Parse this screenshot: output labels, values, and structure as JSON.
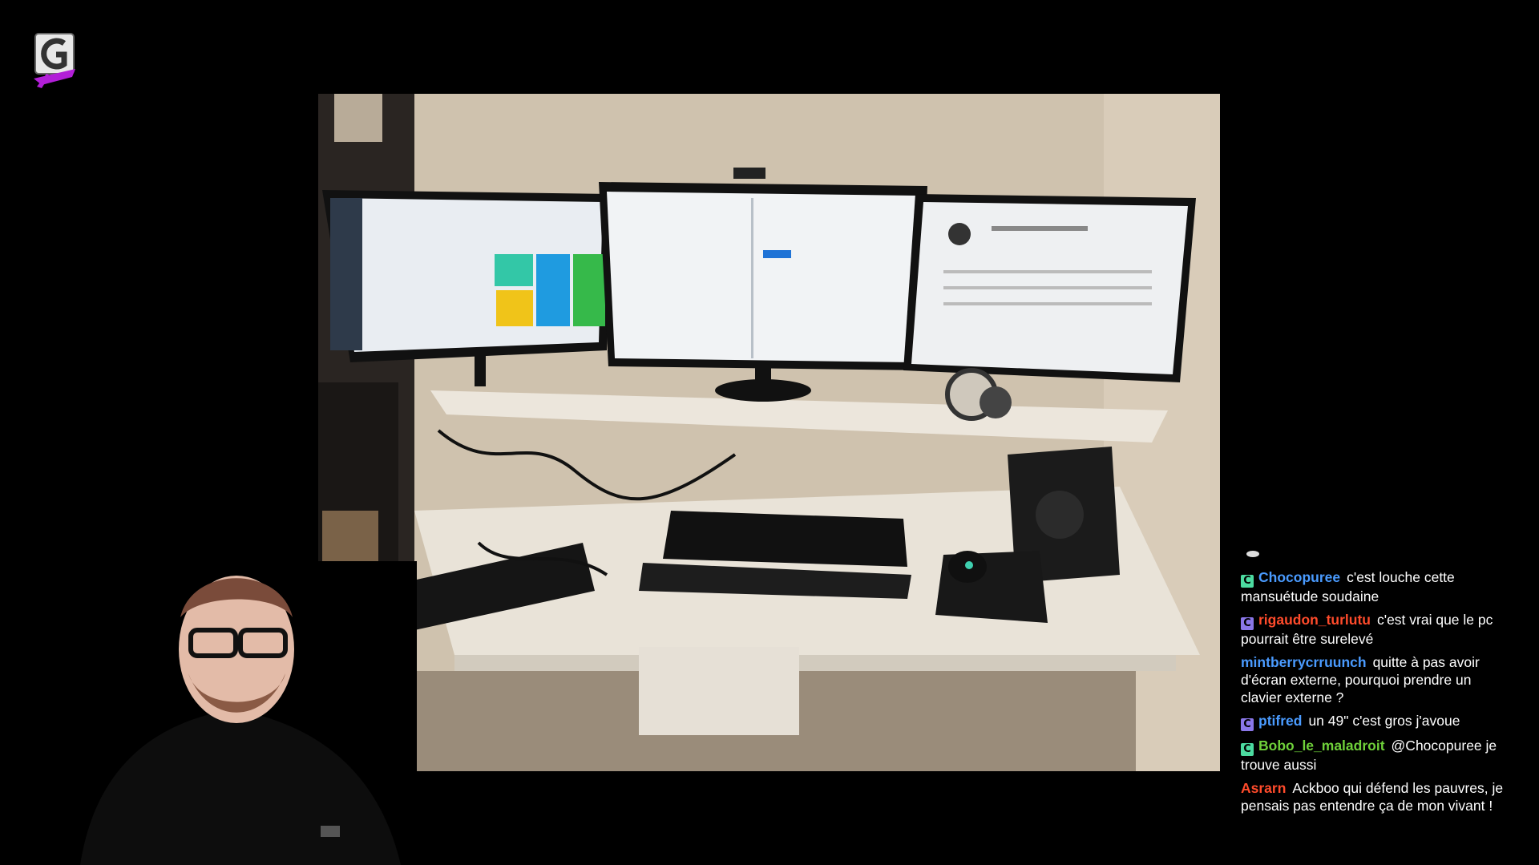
{
  "logo": {
    "icon": "channel-logo-icon",
    "accent": "#b21fd8"
  },
  "chat": {
    "messages": [
      {
        "badge": "C",
        "badge_color": "#4cdba0",
        "user": "Chocopuree",
        "user_color": "#4a9bff",
        "text": "c'est louche cette mansuétude soudaine"
      },
      {
        "badge": "C",
        "badge_color": "#8a77e8",
        "user": "rigaudon_turlutu",
        "user_color": "#ff4b2b",
        "text": "c'est vrai que le pc pourrait être surelevé"
      },
      {
        "badge": "",
        "badge_color": "",
        "user": "mintberrycrruunch",
        "user_color": "#4a9bff",
        "text": "quitte à pas avoir d'écran externe, pourquoi prendre un clavier externe ?"
      },
      {
        "badge": "C",
        "badge_color": "#8a77e8",
        "user": "ptifred",
        "user_color": "#4a9bff",
        "text": "un 49\" c'est gros j'avoue"
      },
      {
        "badge": "C",
        "badge_color": "#4cdba0",
        "user": "Bobo_le_maladroit",
        "user_color": "#6fd13a",
        "text": "@Chocopuree je trouve aussi"
      },
      {
        "badge": "",
        "badge_color": "",
        "user": "Asrarn",
        "user_color": "#ff4b2b",
        "text": "Ackboo qui défend les pauvres, je pensais pas entendre ça de mon vivant !"
      }
    ]
  }
}
